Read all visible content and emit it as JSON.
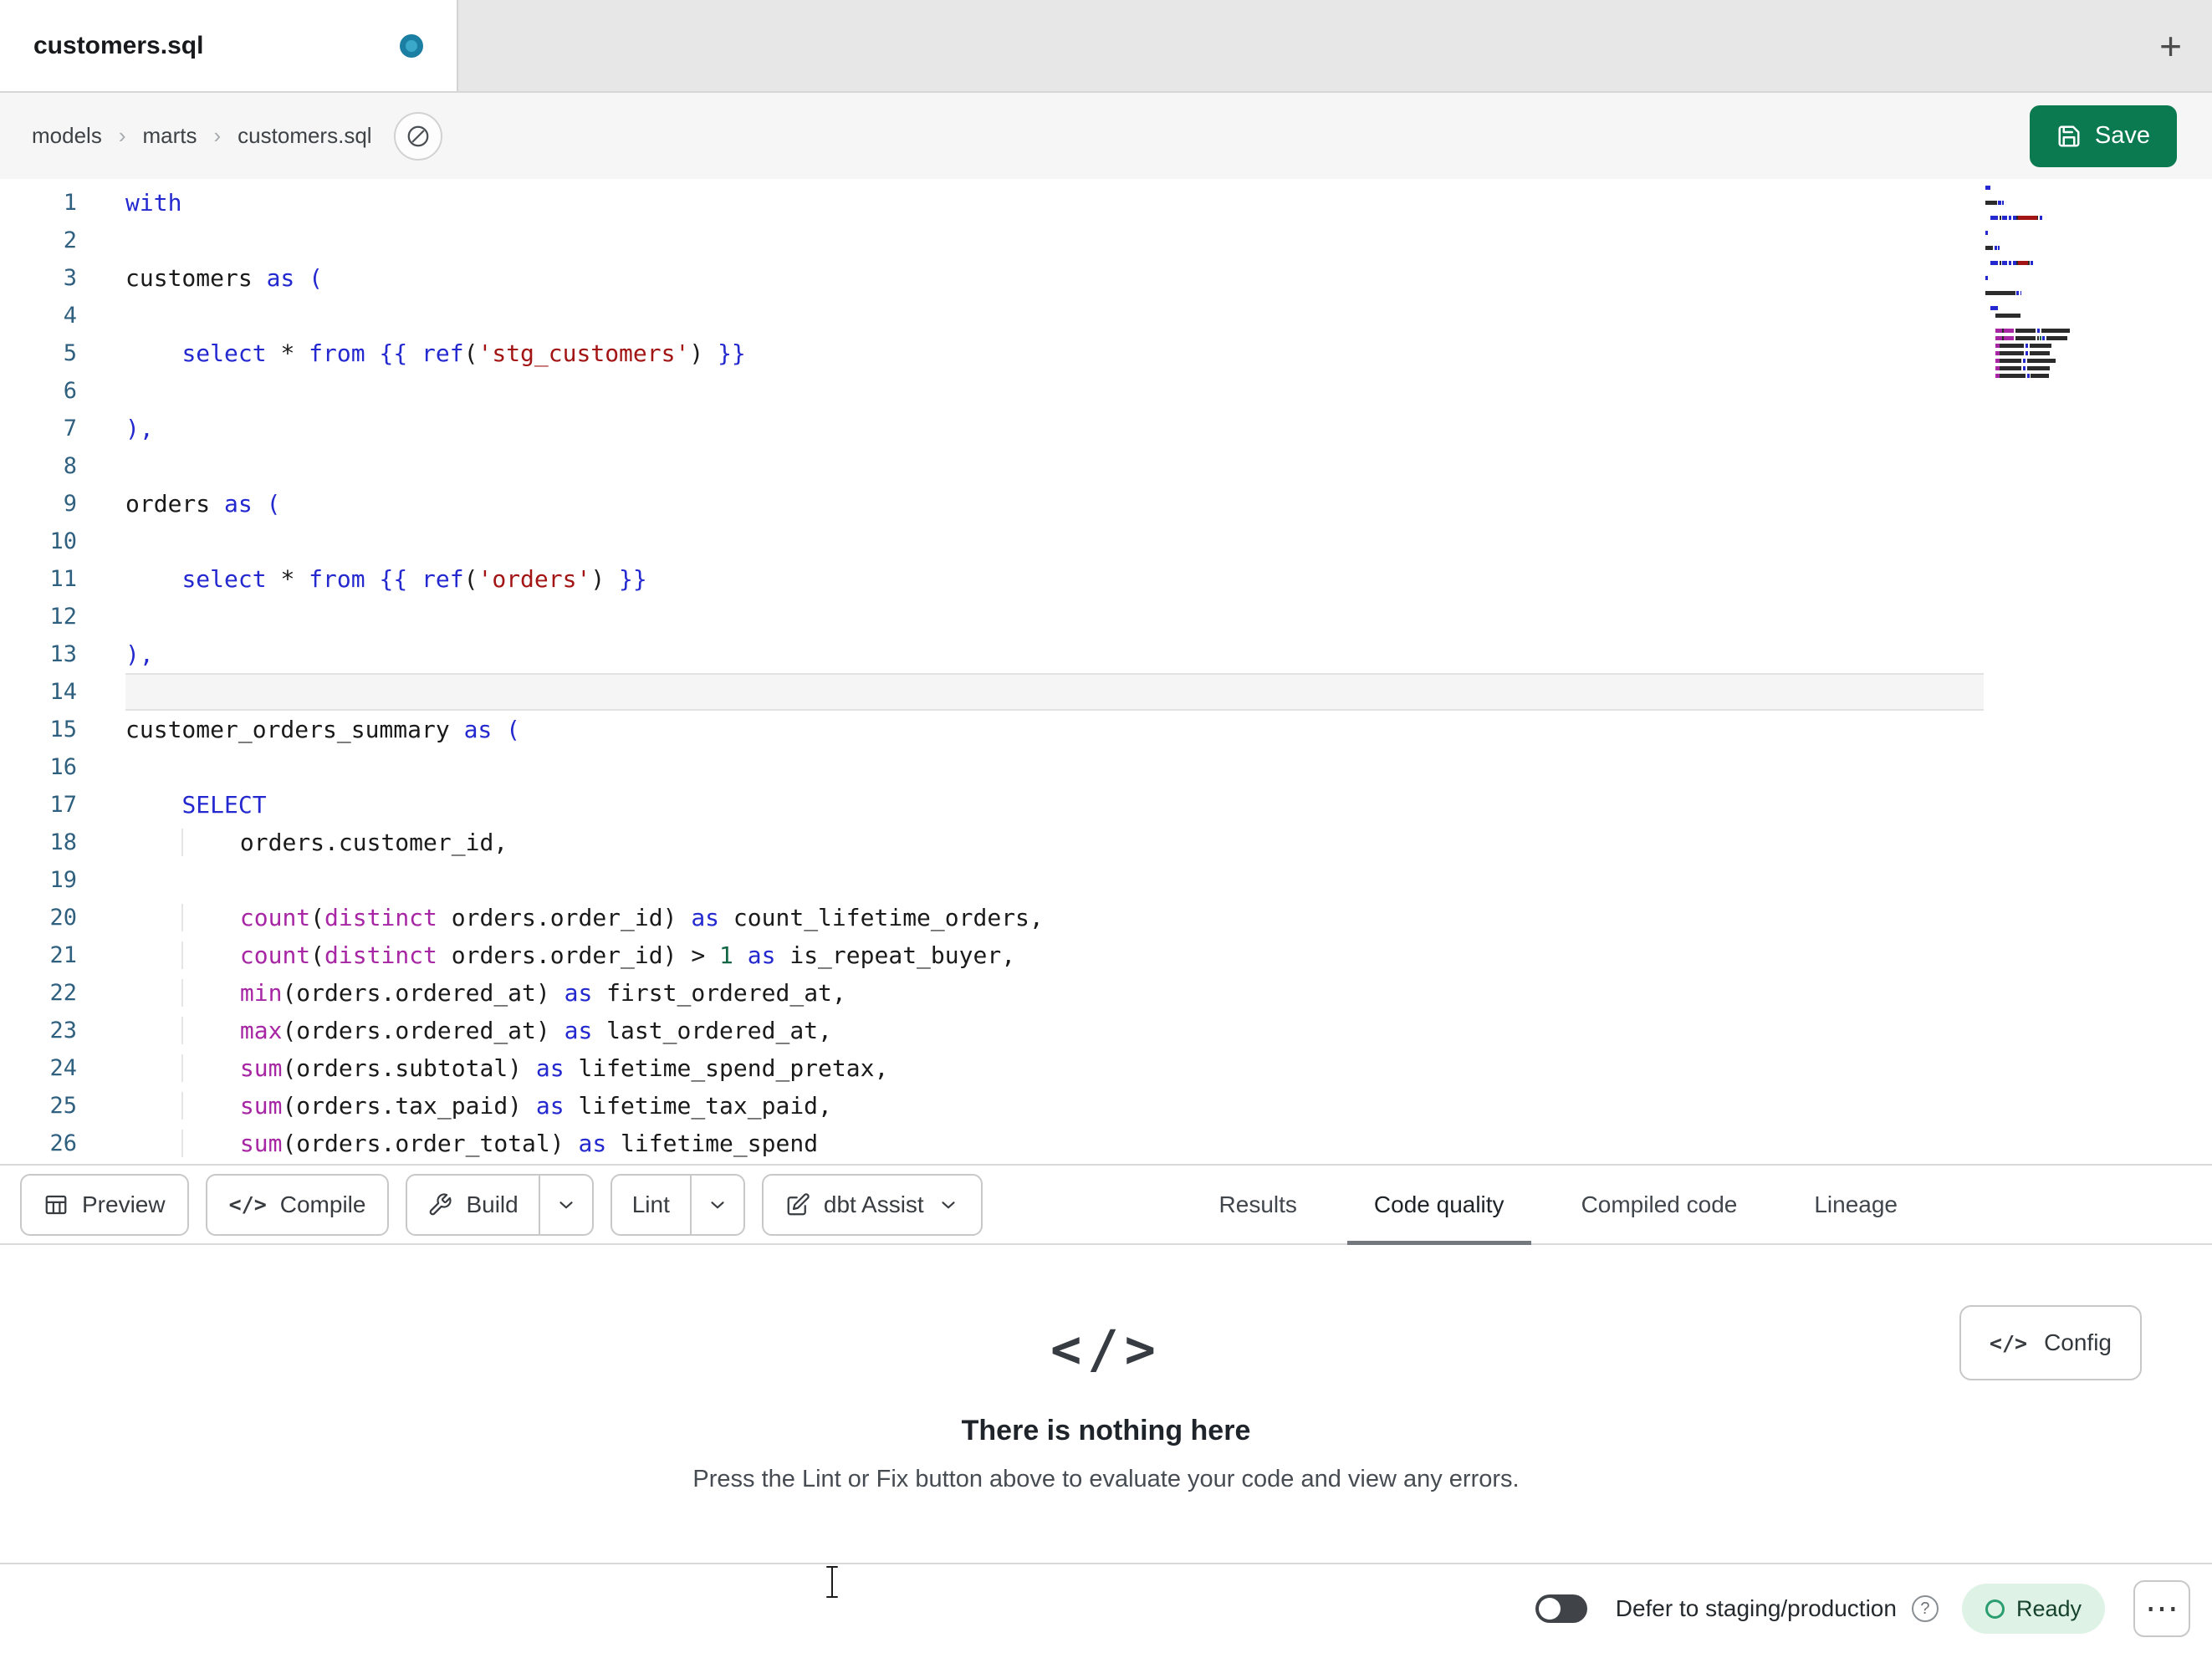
{
  "tab_bar": {
    "active_tab": "customers.sql",
    "new_tab_icon": "+"
  },
  "breadcrumbs": {
    "items": [
      "models",
      "marts",
      "customers.sql"
    ],
    "separator": "›"
  },
  "header": {
    "save_label": "Save"
  },
  "editor": {
    "active_line": 14,
    "lines": [
      {
        "n": 1,
        "tokens": [
          [
            "kw",
            "with"
          ]
        ]
      },
      {
        "n": 2,
        "tokens": []
      },
      {
        "n": 3,
        "tokens": [
          [
            "pl",
            "customers "
          ],
          [
            "kw",
            "as"
          ],
          [
            "pl",
            " "
          ],
          [
            "kw",
            "("
          ]
        ]
      },
      {
        "n": 4,
        "tokens": []
      },
      {
        "n": 5,
        "tokens": [
          [
            "pl",
            "    "
          ],
          [
            "kw",
            "select"
          ],
          [
            "pl",
            " * "
          ],
          [
            "kw",
            "from"
          ],
          [
            "pl",
            " "
          ],
          [
            "kw",
            "{{ "
          ],
          [
            "kw",
            "ref"
          ],
          [
            "pl",
            "("
          ],
          [
            "str",
            "'stg_customers'"
          ],
          [
            "pl",
            ")"
          ],
          [
            "kw",
            " }}"
          ]
        ]
      },
      {
        "n": 6,
        "tokens": []
      },
      {
        "n": 7,
        "tokens": [
          [
            "kw",
            "),"
          ]
        ]
      },
      {
        "n": 8,
        "tokens": []
      },
      {
        "n": 9,
        "tokens": [
          [
            "pl",
            "orders "
          ],
          [
            "kw",
            "as"
          ],
          [
            "pl",
            " "
          ],
          [
            "kw",
            "("
          ]
        ]
      },
      {
        "n": 10,
        "tokens": []
      },
      {
        "n": 11,
        "tokens": [
          [
            "pl",
            "    "
          ],
          [
            "kw",
            "select"
          ],
          [
            "pl",
            " * "
          ],
          [
            "kw",
            "from"
          ],
          [
            "pl",
            " "
          ],
          [
            "kw",
            "{{ "
          ],
          [
            "kw",
            "ref"
          ],
          [
            "pl",
            "("
          ],
          [
            "str",
            "'orders'"
          ],
          [
            "pl",
            ")"
          ],
          [
            "kw",
            " }}"
          ]
        ]
      },
      {
        "n": 12,
        "tokens": []
      },
      {
        "n": 13,
        "tokens": [
          [
            "kw",
            "),"
          ]
        ]
      },
      {
        "n": 14,
        "tokens": []
      },
      {
        "n": 15,
        "tokens": [
          [
            "pl",
            "customer_orders_summary "
          ],
          [
            "kw",
            "as"
          ],
          [
            "pl",
            " "
          ],
          [
            "kw",
            "("
          ]
        ]
      },
      {
        "n": 16,
        "tokens": []
      },
      {
        "n": 17,
        "tokens": [
          [
            "pl",
            "    "
          ],
          [
            "kw",
            "SELECT"
          ]
        ]
      },
      {
        "n": 18,
        "tokens": [
          [
            "pl",
            "        orders.customer_id,"
          ]
        ]
      },
      {
        "n": 19,
        "tokens": []
      },
      {
        "n": 20,
        "tokens": [
          [
            "pl",
            "        "
          ],
          [
            "fn",
            "count"
          ],
          [
            "pl",
            "("
          ],
          [
            "fn",
            "distinct"
          ],
          [
            "pl",
            " orders.order_id) "
          ],
          [
            "kw",
            "as"
          ],
          [
            "pl",
            " count_lifetime_orders,"
          ]
        ]
      },
      {
        "n": 21,
        "tokens": [
          [
            "pl",
            "        "
          ],
          [
            "fn",
            "count"
          ],
          [
            "pl",
            "("
          ],
          [
            "fn",
            "distinct"
          ],
          [
            "pl",
            " orders.order_id) > "
          ],
          [
            "num",
            "1"
          ],
          [
            "pl",
            " "
          ],
          [
            "kw",
            "as"
          ],
          [
            "pl",
            " is_repeat_buyer,"
          ]
        ]
      },
      {
        "n": 22,
        "tokens": [
          [
            "pl",
            "        "
          ],
          [
            "fn",
            "min"
          ],
          [
            "pl",
            "(orders.ordered_at) "
          ],
          [
            "kw",
            "as"
          ],
          [
            "pl",
            " first_ordered_at,"
          ]
        ]
      },
      {
        "n": 23,
        "tokens": [
          [
            "pl",
            "        "
          ],
          [
            "fn",
            "max"
          ],
          [
            "pl",
            "(orders.ordered_at) "
          ],
          [
            "kw",
            "as"
          ],
          [
            "pl",
            " last_ordered_at,"
          ]
        ]
      },
      {
        "n": 24,
        "tokens": [
          [
            "pl",
            "        "
          ],
          [
            "fn",
            "sum"
          ],
          [
            "pl",
            "(orders.subtotal) "
          ],
          [
            "kw",
            "as"
          ],
          [
            "pl",
            " lifetime_spend_pretax,"
          ]
        ]
      },
      {
        "n": 25,
        "tokens": [
          [
            "pl",
            "        "
          ],
          [
            "fn",
            "sum"
          ],
          [
            "pl",
            "(orders.tax_paid) "
          ],
          [
            "kw",
            "as"
          ],
          [
            "pl",
            " lifetime_tax_paid,"
          ]
        ]
      },
      {
        "n": 26,
        "tokens": [
          [
            "pl",
            "        "
          ],
          [
            "fn",
            "sum"
          ],
          [
            "pl",
            "(orders.order_total) "
          ],
          [
            "kw",
            "as"
          ],
          [
            "pl",
            " lifetime_spend"
          ]
        ]
      }
    ]
  },
  "toolbar": {
    "preview_label": "Preview",
    "compile_label": "Compile",
    "compile_icon": "</>",
    "build_label": "Build",
    "lint_label": "Lint",
    "assist_label": "dbt Assist"
  },
  "panel_tabs": [
    {
      "label": "Results",
      "active": false
    },
    {
      "label": "Code quality",
      "active": true
    },
    {
      "label": "Compiled code",
      "active": false
    },
    {
      "label": "Lineage",
      "active": false
    }
  ],
  "results_panel": {
    "config_label": "Config",
    "config_icon": "</>",
    "empty_icon": "</>",
    "empty_title": "There is nothing here",
    "empty_subtitle": "Press the Lint or Fix button above to evaluate your code and view any errors."
  },
  "status_bar": {
    "defer_label": "Defer to staging/production",
    "help_icon": "?",
    "ready_label": "Ready",
    "menu_icon": "⋯"
  },
  "colors": {
    "save_button": "#0c7a50",
    "unsaved_dot": "#1a7fa3",
    "ready_bg": "#def2e6",
    "ready_icon": "#2a9e6f",
    "syntax_keyword": "#2429cf",
    "syntax_function": "#a626a4",
    "syntax_string": "#a31515",
    "syntax_number": "#116644"
  }
}
